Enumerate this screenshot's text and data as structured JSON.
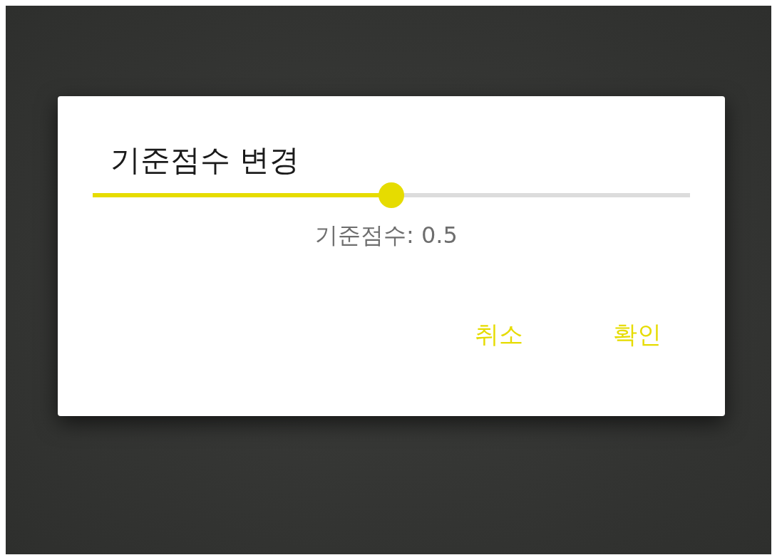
{
  "dialog": {
    "title": "기준점수 변경",
    "slider": {
      "level": 0.5
    },
    "reading": "기준점수: 0.5",
    "buttons": [
      {
        "label": "취소"
      },
      {
        "label": "확인"
      }
    ]
  }
}
